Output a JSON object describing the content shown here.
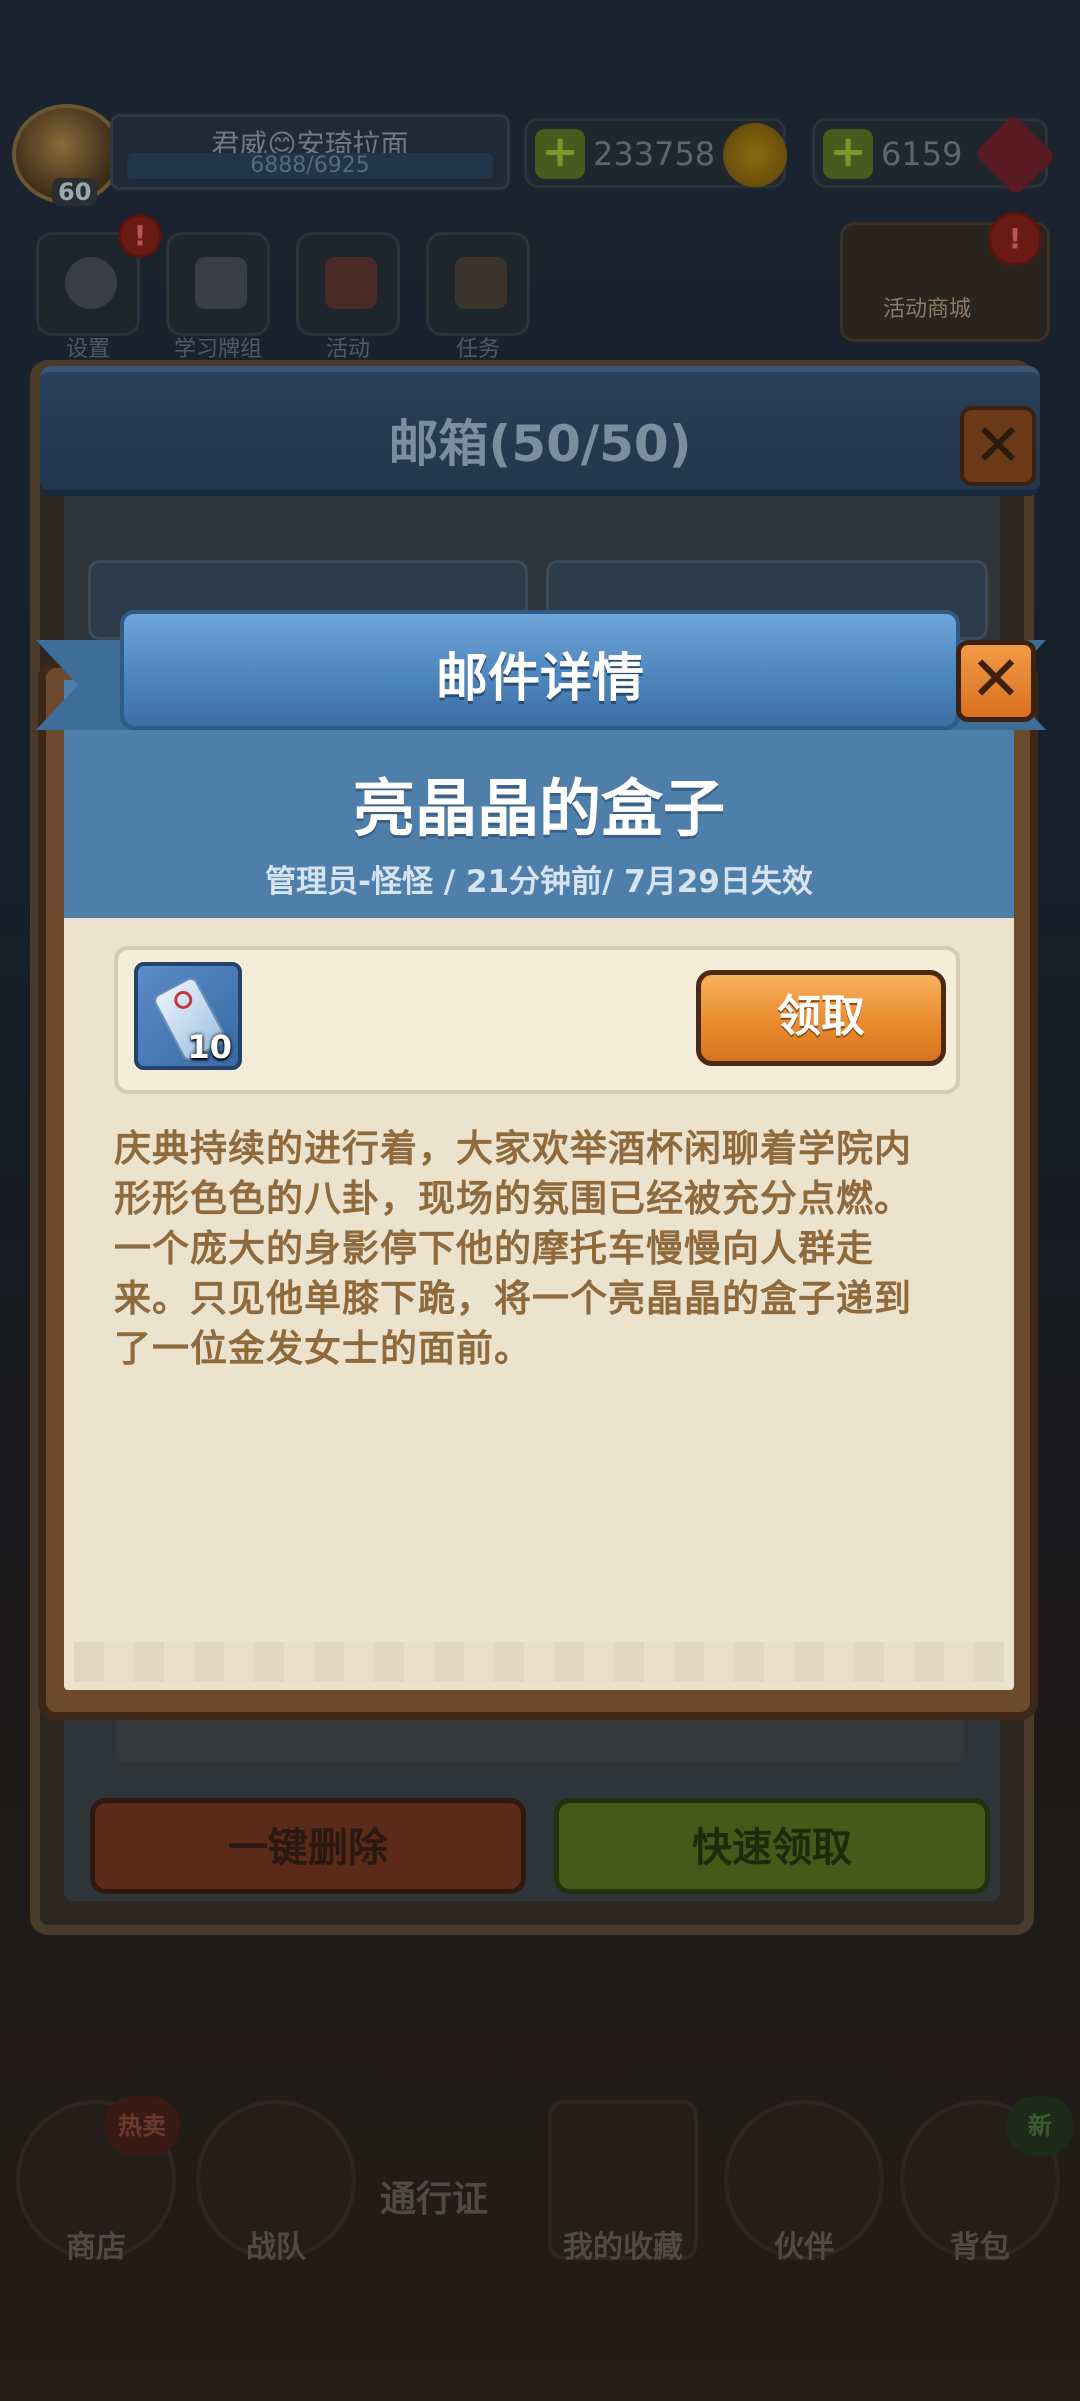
{
  "player": {
    "name": "君威😊安琦拉面",
    "level": "60",
    "exp": "6888/6925"
  },
  "resources": {
    "coins": "233758",
    "gems": "6159"
  },
  "top_buttons": {
    "settings": "设置",
    "study_deck": "学习牌组",
    "events": "活动",
    "tasks": "任务",
    "event_shop": "活动商城",
    "badge": "!"
  },
  "mailbox": {
    "title": "邮箱(50/50)",
    "delete_all_label": "一键删除",
    "quick_claim_label": "快速领取"
  },
  "mail_detail": {
    "dialog_title": "邮件详情",
    "close": "✕",
    "mail_title": "亮晶晶的盒子",
    "meta": "管理员-怪怪 / 21分钟前/  7月29日失效",
    "attachment_qty": "10",
    "claim_label": "领取",
    "body": "庆典持续的进行着，大家欢举酒杯闲聊着学院内形形色色的八卦，现场的氛围已经被充分点燃。一个庞大的身影停下他的摩托车慢慢向人群走来。只见他单膝下跪，将一个亮晶晶的盒子递到了一位金发女士的面前。"
  },
  "bottom_nav": {
    "shop": "商店",
    "shop_tag": "热卖",
    "team": "战队",
    "pass": "通行证",
    "collection": "我的收藏",
    "partner": "伙伴",
    "bag": "背包",
    "bag_tag": "新"
  },
  "colors": {
    "header_blue": "#4e7fab",
    "paper": "#ece3cf",
    "claim_orange": "#e8892c",
    "body_text": "#8e6a3c"
  }
}
